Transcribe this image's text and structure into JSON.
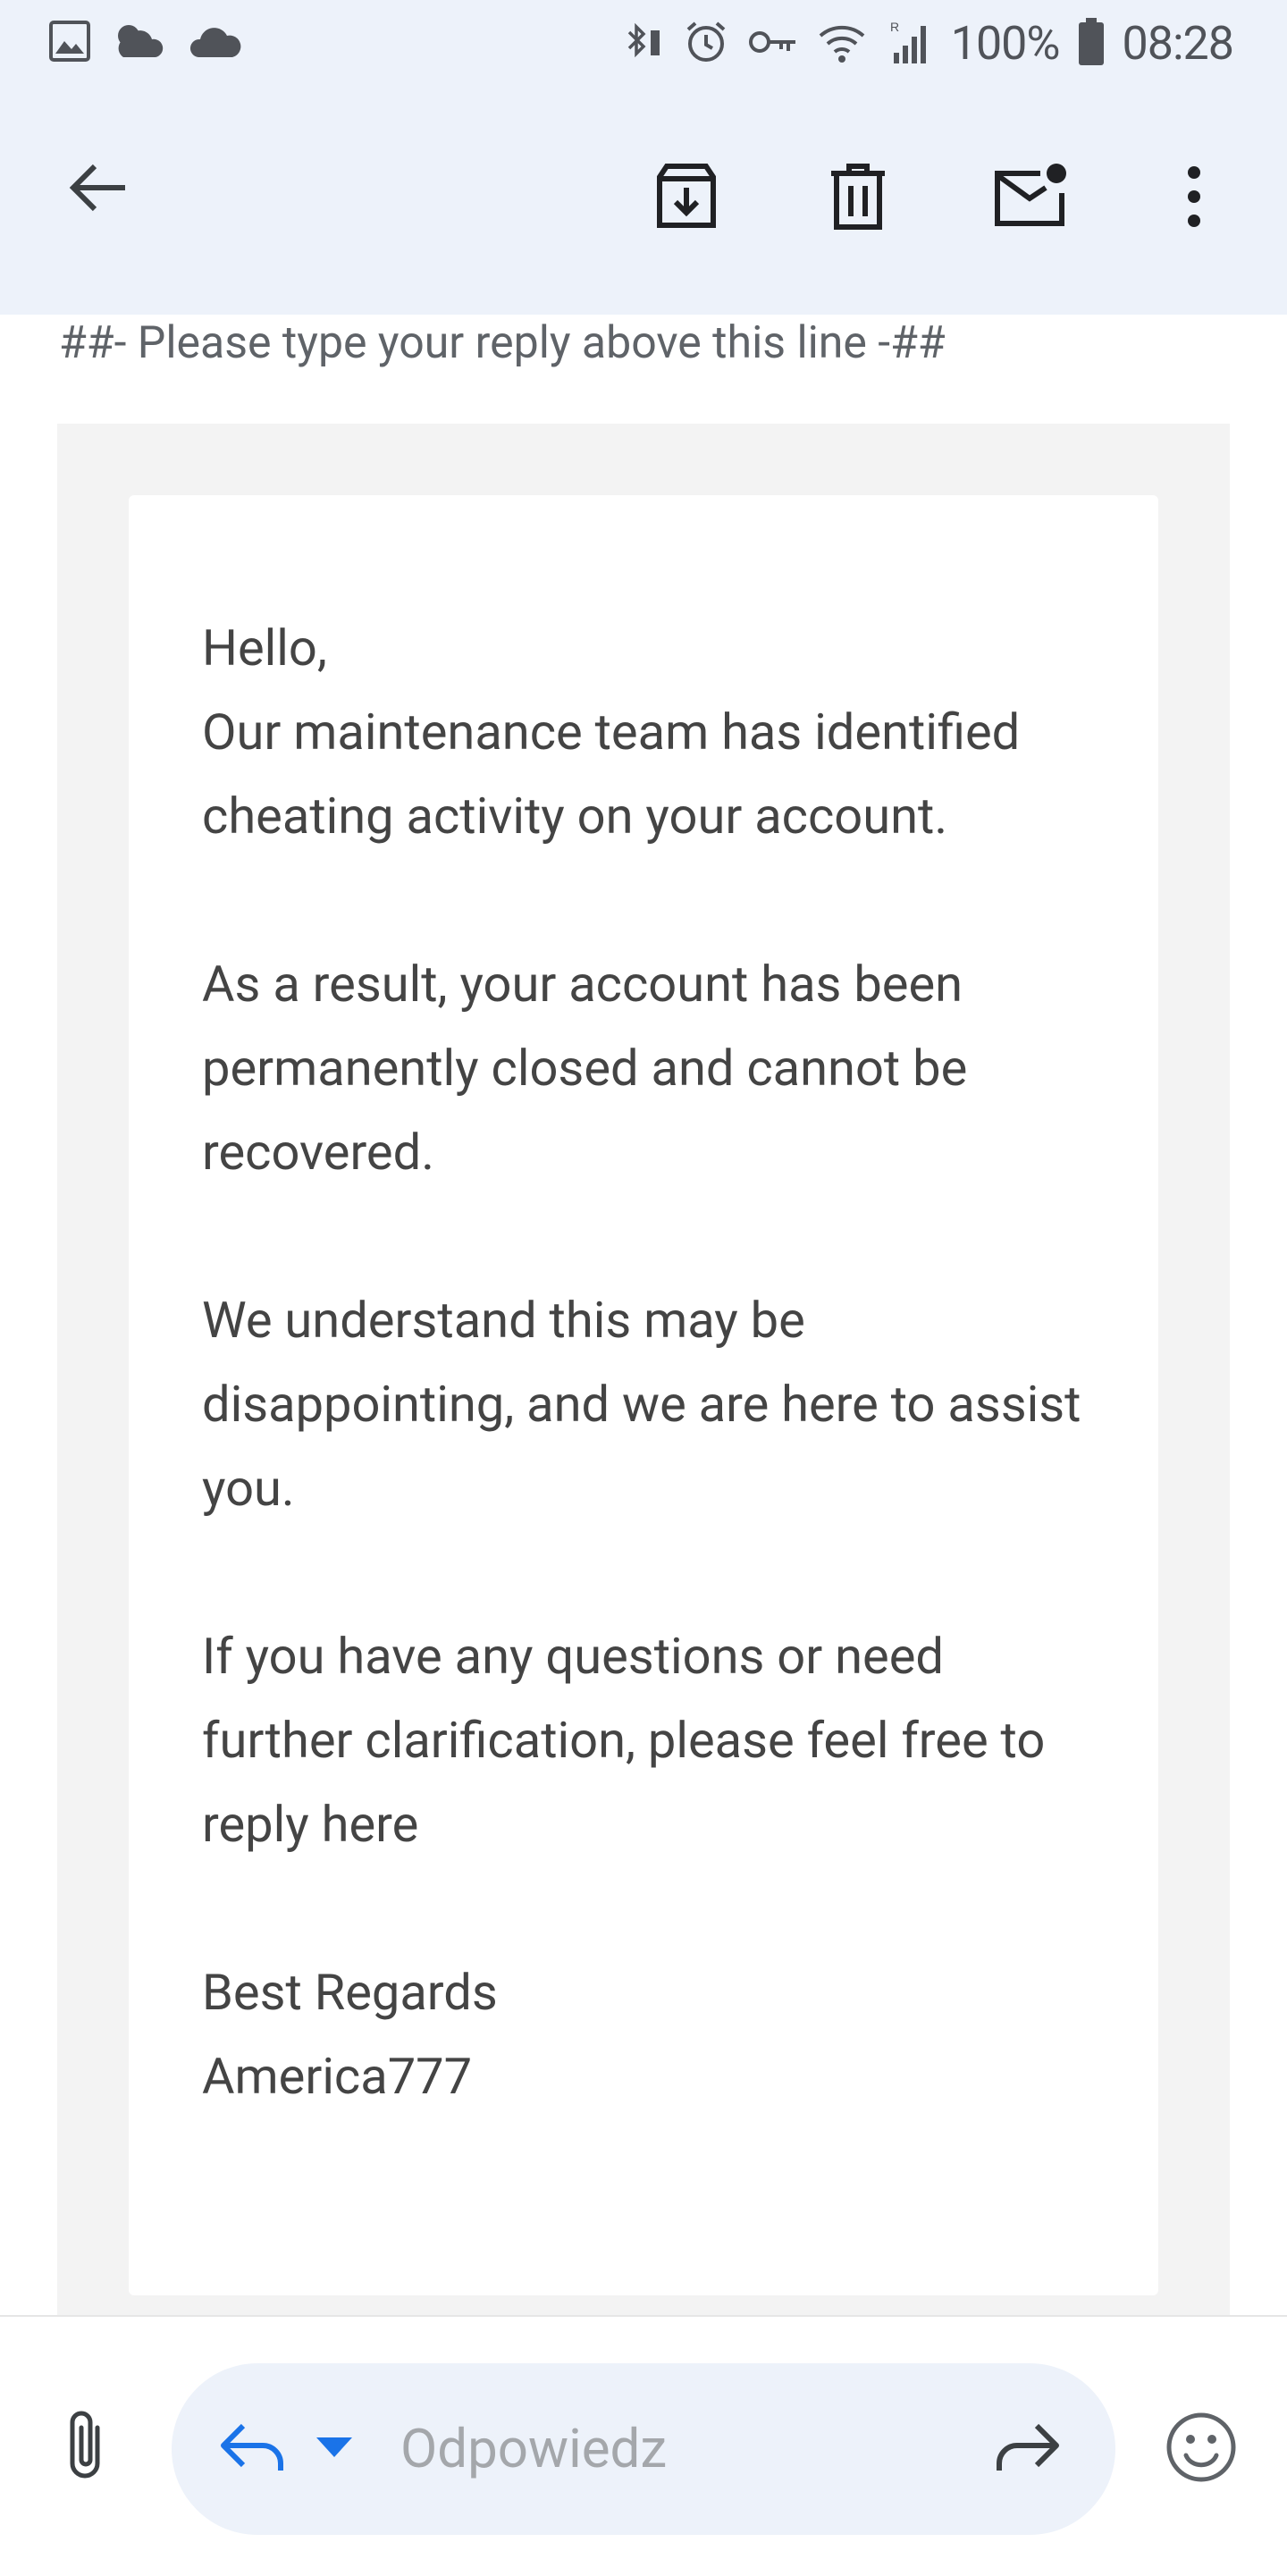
{
  "status_bar": {
    "left_icons": [
      "image-icon",
      "weather-icon",
      "cloud-icon"
    ],
    "right_icons": [
      "bluetooth-icon",
      "alarm-icon",
      "vpn-key-icon",
      "wifi-icon",
      "signal-icon",
      "battery-icon"
    ],
    "battery_percent": "100%",
    "time": "08:28"
  },
  "app_bar": {
    "back_icon": "arrow-back-icon",
    "actions": [
      "archive-icon",
      "delete-icon",
      "mark-unread-icon",
      "more-vert-icon"
    ]
  },
  "email": {
    "reply_marker": "##- Please type your reply above this line -##",
    "paragraphs": [
      [
        "Hello,",
        "Our maintenance team has identified cheating activity on your account."
      ],
      [
        "As a result, your account has been permanently closed and cannot be recovered."
      ],
      [
        "We understand this may be disappointing, and we are here to assist you."
      ],
      [
        "If you have any questions or need further clarification, please feel free to reply here"
      ],
      [
        "Best Regards",
        "America777"
      ]
    ]
  },
  "bottom_bar": {
    "attach_icon": "paperclip-icon",
    "reply_placeholder": "Odpowiedz",
    "reply_icon": "reply-icon",
    "dropdown_icon": "caret-down-icon",
    "forward_icon": "forward-icon",
    "emoji_icon": "emoji-icon"
  },
  "colors": {
    "bar_background": "#edf2fa",
    "accent_blue": "#1a73e8",
    "text": "#444444"
  }
}
